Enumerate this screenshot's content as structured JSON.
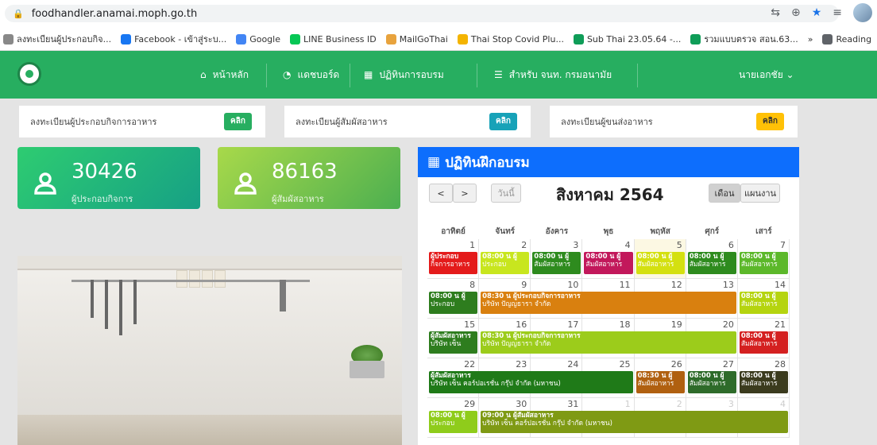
{
  "browser": {
    "url": "foodhandler.anamai.moph.go.th"
  },
  "bookmarks": [
    {
      "label": "ลงทะเบียนผู้ประกอบกิจ...",
      "icon": "bookmark-icon",
      "color": "#888888"
    },
    {
      "label": "Facebook - เข้าสู่ระบ...",
      "icon": "facebook-icon",
      "color": "#1877f2"
    },
    {
      "label": "Google",
      "icon": "google-icon",
      "color": "#4285f4"
    },
    {
      "label": "LINE Business ID",
      "icon": "line-icon",
      "color": "#06c755"
    },
    {
      "label": "MailGoThai",
      "icon": "mailgothai-icon",
      "color": "#e8a33d"
    },
    {
      "label": "Thai Stop Covid Plu...",
      "icon": "thai-stop-covid-icon",
      "color": "#f4b400"
    },
    {
      "label": "Sub Thai 23.05.64 -...",
      "icon": "drive-icon",
      "color": "#0f9d58"
    },
    {
      "label": "รวมแบบตรวจ สอน.63...",
      "icon": "drive-icon",
      "color": "#0f9d58"
    },
    {
      "label": "»",
      "icon": "more-icon",
      "color": "#5f6368"
    },
    {
      "label": "Reading",
      "icon": "reading-list-icon",
      "color": "#5f6368"
    }
  ],
  "nav": {
    "items": [
      {
        "label": "หน้าหลัก",
        "icon": "home-icon"
      },
      {
        "label": "แดชบอร์ด",
        "icon": "dashboard-icon"
      },
      {
        "label": "ปฏิทินการอบรม",
        "icon": "calendar-icon"
      },
      {
        "label": "สำหรับ จนท. กรมอนามัย",
        "icon": "list-icon"
      },
      {
        "label": "นายเอกชัย ⌄",
        "icon": "user-menu"
      }
    ]
  },
  "register": [
    {
      "label": "ลงทะเบียนผู้ประกอบกิจการอาหาร",
      "btn": "คลิก",
      "color": "#27ae60"
    },
    {
      "label": "ลงทะเบียนผู้สัมผัสอาหาร",
      "btn": "คลิก",
      "color": "#17a2b8"
    },
    {
      "label": "ลงทะเบียนผู้ขนส่งอาหาร",
      "btn": "คลิก",
      "color": "#ffc107"
    }
  ],
  "stats": [
    {
      "value": "30426",
      "label": "ผู้ประกอบกิจการ"
    },
    {
      "value": "86163",
      "label": "ผู้สัมผัสอาหาร"
    }
  ],
  "calendar": {
    "title": "ปฏิทินฝึกอบรม",
    "prev": "<",
    "next": ">",
    "today": "วันนี้",
    "month": "สิงหาคม 2564",
    "view_month": "เดือน",
    "view_list": "แผนงาน",
    "weekdays": [
      "อาทิตย์",
      "จันทร์",
      "อังคาร",
      "พุธ",
      "พฤหัส",
      "ศุกร์",
      "เสาร์"
    ],
    "weeks": [
      [
        "1",
        "2",
        "3",
        "4",
        "5",
        "6",
        "7"
      ],
      [
        "8",
        "9",
        "10",
        "11",
        "12",
        "13",
        "14"
      ],
      [
        "15",
        "16",
        "17",
        "18",
        "19",
        "20",
        "21"
      ],
      [
        "22",
        "23",
        "24",
        "25",
        "26",
        "27",
        "28"
      ],
      [
        "29",
        "30",
        "31",
        "1",
        "2",
        "3",
        "4"
      ]
    ],
    "events": [
      {
        "week": 0,
        "start": 0,
        "span": 1,
        "color": "#e41b1b",
        "l1": "ผู้ประกอบ",
        "l2": "กิจการอาหาร"
      },
      {
        "week": 0,
        "start": 1,
        "span": 1,
        "color": "#c8e61e",
        "l1": "08:00 น ผู้",
        "l2": "ประกอบ"
      },
      {
        "week": 0,
        "start": 2,
        "span": 1,
        "color": "#2e8b1e",
        "l1": "08:00 น ผู้",
        "l2": "สัมผัสอาหาร"
      },
      {
        "week": 0,
        "start": 3,
        "span": 1,
        "color": "#c2185b",
        "l1": "08:00 น ผู้",
        "l2": "สัมผัสอาหาร"
      },
      {
        "week": 0,
        "start": 4,
        "span": 1,
        "color": "#d4e010",
        "l1": "08:00 น ผู้",
        "l2": "สัมผัสอาหาร"
      },
      {
        "week": 0,
        "start": 5,
        "span": 1,
        "color": "#2e8b1e",
        "l1": "08:00 น ผู้",
        "l2": "สัมผัสอาหาร"
      },
      {
        "week": 0,
        "start": 6,
        "span": 1,
        "color": "#5cb82a",
        "l1": "08:00 น ผู้",
        "l2": "สัมผัสอาหาร"
      },
      {
        "week": 1,
        "start": 0,
        "span": 1,
        "color": "#2e7d1e",
        "l1": "08:00 น ผู้",
        "l2": "ประกอบ"
      },
      {
        "week": 1,
        "start": 1,
        "span": 5,
        "color": "#d9800f",
        "l1": "08:30 น ผู้ประกอบกิจการอาหาร",
        "l2": "บริษัท ปัญญธารา จำกัด"
      },
      {
        "week": 1,
        "start": 6,
        "span": 1,
        "color": "#b5d40f",
        "l1": "08:00 น ผู้",
        "l2": "สัมผัสอาหาร"
      },
      {
        "week": 2,
        "start": 0,
        "span": 1,
        "color": "#2e7d1e",
        "l1": "ผู้สัมผัสอาหาร",
        "l2": "บริษัท เซ็น"
      },
      {
        "week": 2,
        "start": 1,
        "span": 5,
        "color": "#9ccc1b",
        "l1": "08:30 น ผู้ประกอบกิจการอาหาร",
        "l2": "บริษัท ปัญญธารา จำกัด"
      },
      {
        "week": 2,
        "start": 6,
        "span": 1,
        "color": "#d42020",
        "l1": "08:00 น ผู้",
        "l2": "สัมผัสอาหาร"
      },
      {
        "week": 3,
        "start": 0,
        "span": 4,
        "color": "#1f7a18",
        "l1": "ผู้สัมผัสอาหาร",
        "l2": "บริษัท เซ็น คอร์ปอเรชั่น กรุ๊ป จำกัด (มหาชน)"
      },
      {
        "week": 3,
        "start": 4,
        "span": 1,
        "color": "#b06010",
        "l1": "08:30 น ผู้",
        "l2": "สัมผัสอาหาร"
      },
      {
        "week": 3,
        "start": 5,
        "span": 1,
        "color": "#2e6b2a",
        "l1": "08:00 น ผู้",
        "l2": "สัมผัสอาหาร"
      },
      {
        "week": 3,
        "start": 6,
        "span": 1,
        "color": "#3b3b1e",
        "l1": "08:00 น ผู้",
        "l2": "สัมผัสอาหาร"
      },
      {
        "week": 4,
        "start": 0,
        "span": 1,
        "color": "#8fcc1b",
        "l1": "08:00 น ผู้",
        "l2": "ประกอบ"
      },
      {
        "week": 4,
        "start": 1,
        "span": 6,
        "color": "#7f9a14",
        "l1": "09:00 น ผู้สัมผัสอาหาร",
        "l2": "บริษัท เซ็น คอร์ปอเรชั่น กรุ๊ป จำกัด (มหาชน)"
      }
    ]
  }
}
